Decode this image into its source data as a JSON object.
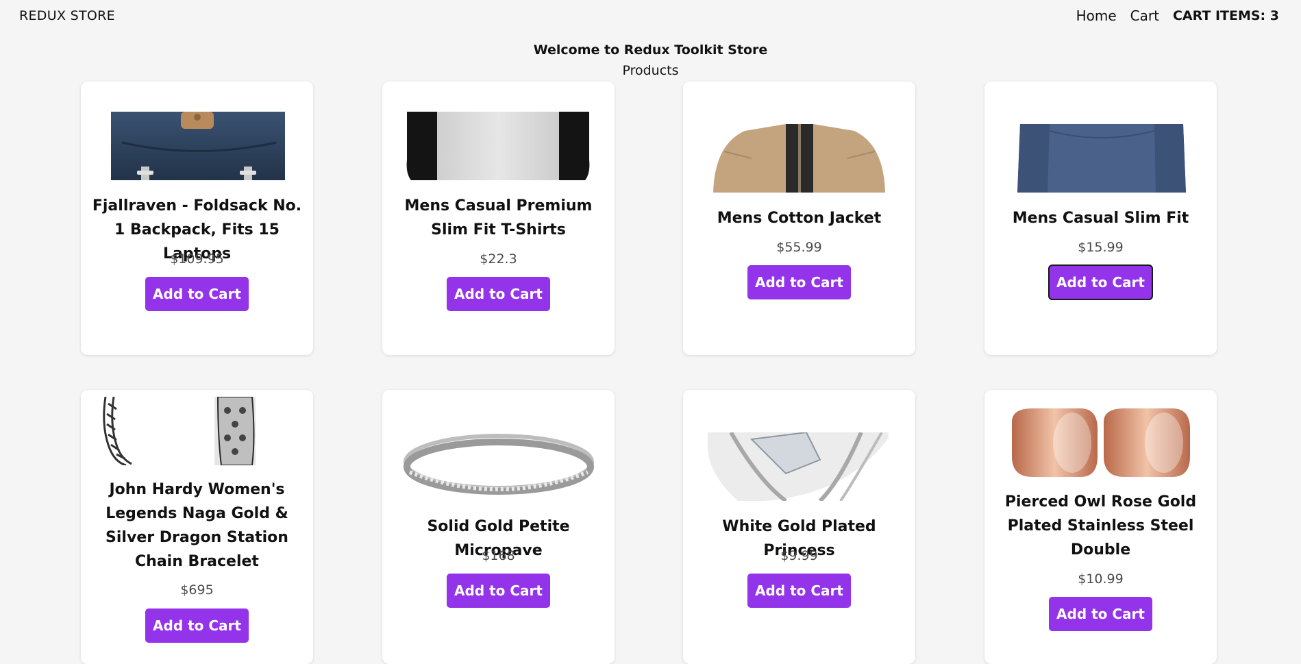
{
  "nav": {
    "brand": "REDUX STORE",
    "home_label": "Home",
    "cart_label": "Cart",
    "cart_items_label": "CART ITEMS: 3"
  },
  "header": {
    "welcome": "Welcome to Redux Toolkit Store",
    "products_heading": "Products"
  },
  "products": [
    {
      "title": "Fjallraven - Foldsack No. 1 Backpack, Fits 15 Laptops",
      "price": "$109.95",
      "button": "Add to Cart"
    },
    {
      "title": "Mens Casual Premium Slim Fit T-Shirts",
      "price": "$22.3",
      "button": "Add to Cart"
    },
    {
      "title": "Mens Cotton Jacket",
      "price": "$55.99",
      "button": "Add to Cart"
    },
    {
      "title": "Mens Casual Slim Fit",
      "price": "$15.99",
      "button": "Add to Cart"
    },
    {
      "title": "John Hardy Women's Legends Naga Gold & Silver Dragon Station Chain Bracelet",
      "price": "$695",
      "button": "Add to Cart"
    },
    {
      "title": "Solid Gold Petite Micropave",
      "price": "$168",
      "button": "Add to Cart"
    },
    {
      "title": "White Gold Plated Princess",
      "price": "$9.99",
      "button": "Add to Cart"
    },
    {
      "title": "Pierced Owl Rose Gold Plated Stainless Steel Double",
      "price": "$10.99",
      "button": "Add to Cart"
    }
  ],
  "colors": {
    "accent": "#9333ea",
    "background": "#f5f5f5",
    "card": "#ffffff"
  }
}
